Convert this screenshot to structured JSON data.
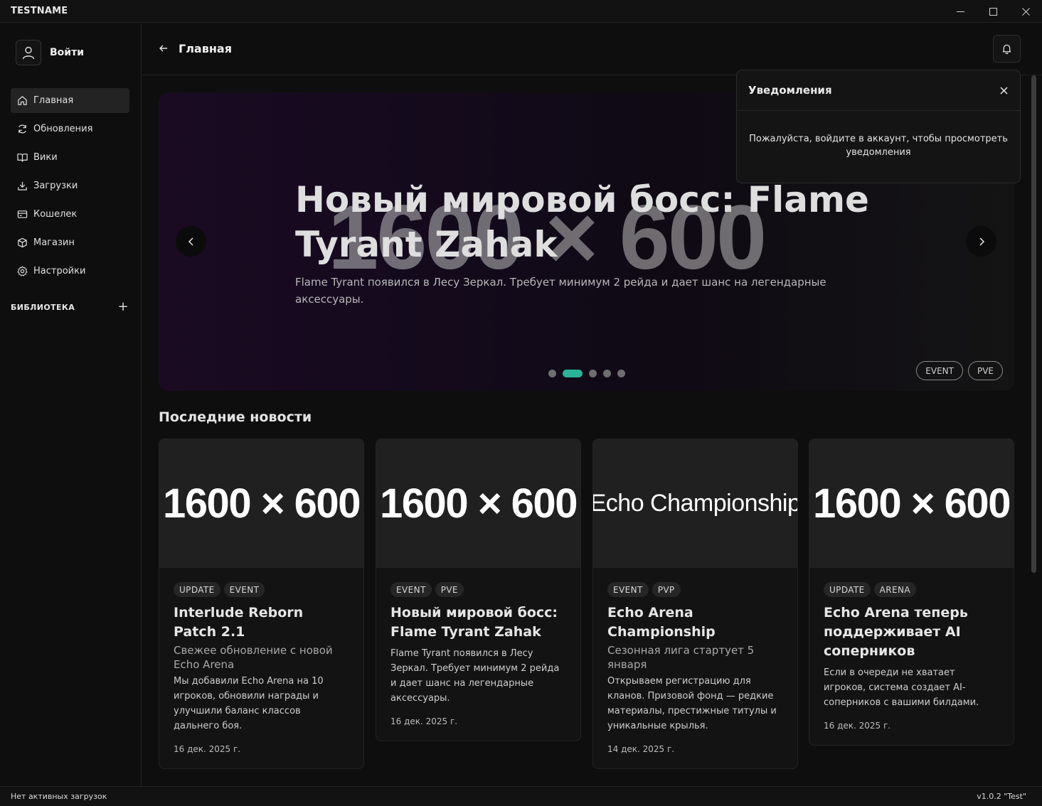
{
  "window": {
    "title": "TESTNAME",
    "controls": {
      "minimize": "─",
      "maximize": "☐",
      "close": "✕"
    }
  },
  "sidebar": {
    "login_label": "Войти",
    "items": [
      {
        "label": "Главная",
        "icon": "home-icon",
        "active": true
      },
      {
        "label": "Обновления",
        "icon": "refresh-icon"
      },
      {
        "label": "Вики",
        "icon": "book-icon"
      },
      {
        "label": "Загрузки",
        "icon": "download-icon"
      },
      {
        "label": "Кошелек",
        "icon": "wallet-icon"
      },
      {
        "label": "Магазин",
        "icon": "box-icon"
      },
      {
        "label": "Настройки",
        "icon": "gear-icon"
      }
    ],
    "library": {
      "title": "БИБЛИОТЕКА",
      "add": "+"
    }
  },
  "header": {
    "title": "Главная"
  },
  "hero": {
    "placeholder": "1600 × 600",
    "title": "Новый мировой босс: Flame Tyrant Zahak",
    "description": "Flame Tyrant появился в Лесу Зеркал. Требует минимум 2 рейда и дает шанс на легендарные аксессуары.",
    "tags": [
      "EVENT",
      "PVE"
    ],
    "slides_total": 5,
    "active_slide": 2
  },
  "notifications": {
    "title": "Уведомления",
    "message": "Пожалуйста, войдите в аккаунт, чтобы просмотреть уведомления"
  },
  "news": {
    "title": "Последние новости",
    "cards": [
      {
        "image_text": "1600 × 600",
        "tags": [
          "UPDATE",
          "EVENT"
        ],
        "title": "Interlude Reborn Patch 2.1",
        "subtitle": "Свежее обновление с новой Echo Arena",
        "text": "Мы добавили Echo Arena на 10 игроков, обновили награды и улучшили баланс классов дальнего боя.",
        "date": "16 дек. 2025 г."
      },
      {
        "image_text": "1600 × 600",
        "tags": [
          "EVENT",
          "PVE"
        ],
        "title": "Новый мировой босс: Flame Tyrant Zahak",
        "subtitle": "",
        "text": "Flame Tyrant появился в Лесу Зеркал. Требует минимум 2 рейда и дает шанс на легендарные аксессуары.",
        "date": "16 дек. 2025 г."
      },
      {
        "image_text": "Echo Championship",
        "tags": [
          "EVENT",
          "PVP"
        ],
        "title": "Echo Arena Championship",
        "subtitle": "Сезонная лига стартует 5 января",
        "text": "Открываем регистрацию для кланов. Призовой фонд — редкие материалы, престижные титулы и уникальные крылья.",
        "date": "14 дек. 2025 г."
      },
      {
        "image_text": "1600 × 600",
        "tags": [
          "UPDATE",
          "ARENA"
        ],
        "title": "Echo Arena теперь поддерживает AI соперников",
        "subtitle": "",
        "text": "Если в очереди не хватает игроков, система создает AI-соперников с вашими билдами.",
        "date": "16 дек. 2025 г."
      }
    ]
  },
  "status": {
    "downloads": "Нет активных загрузок",
    "version": "v1.0.2 \"Test\""
  },
  "colors": {
    "accent": "#2ab398",
    "background": "#0e0e0e",
    "card": "#131313"
  }
}
